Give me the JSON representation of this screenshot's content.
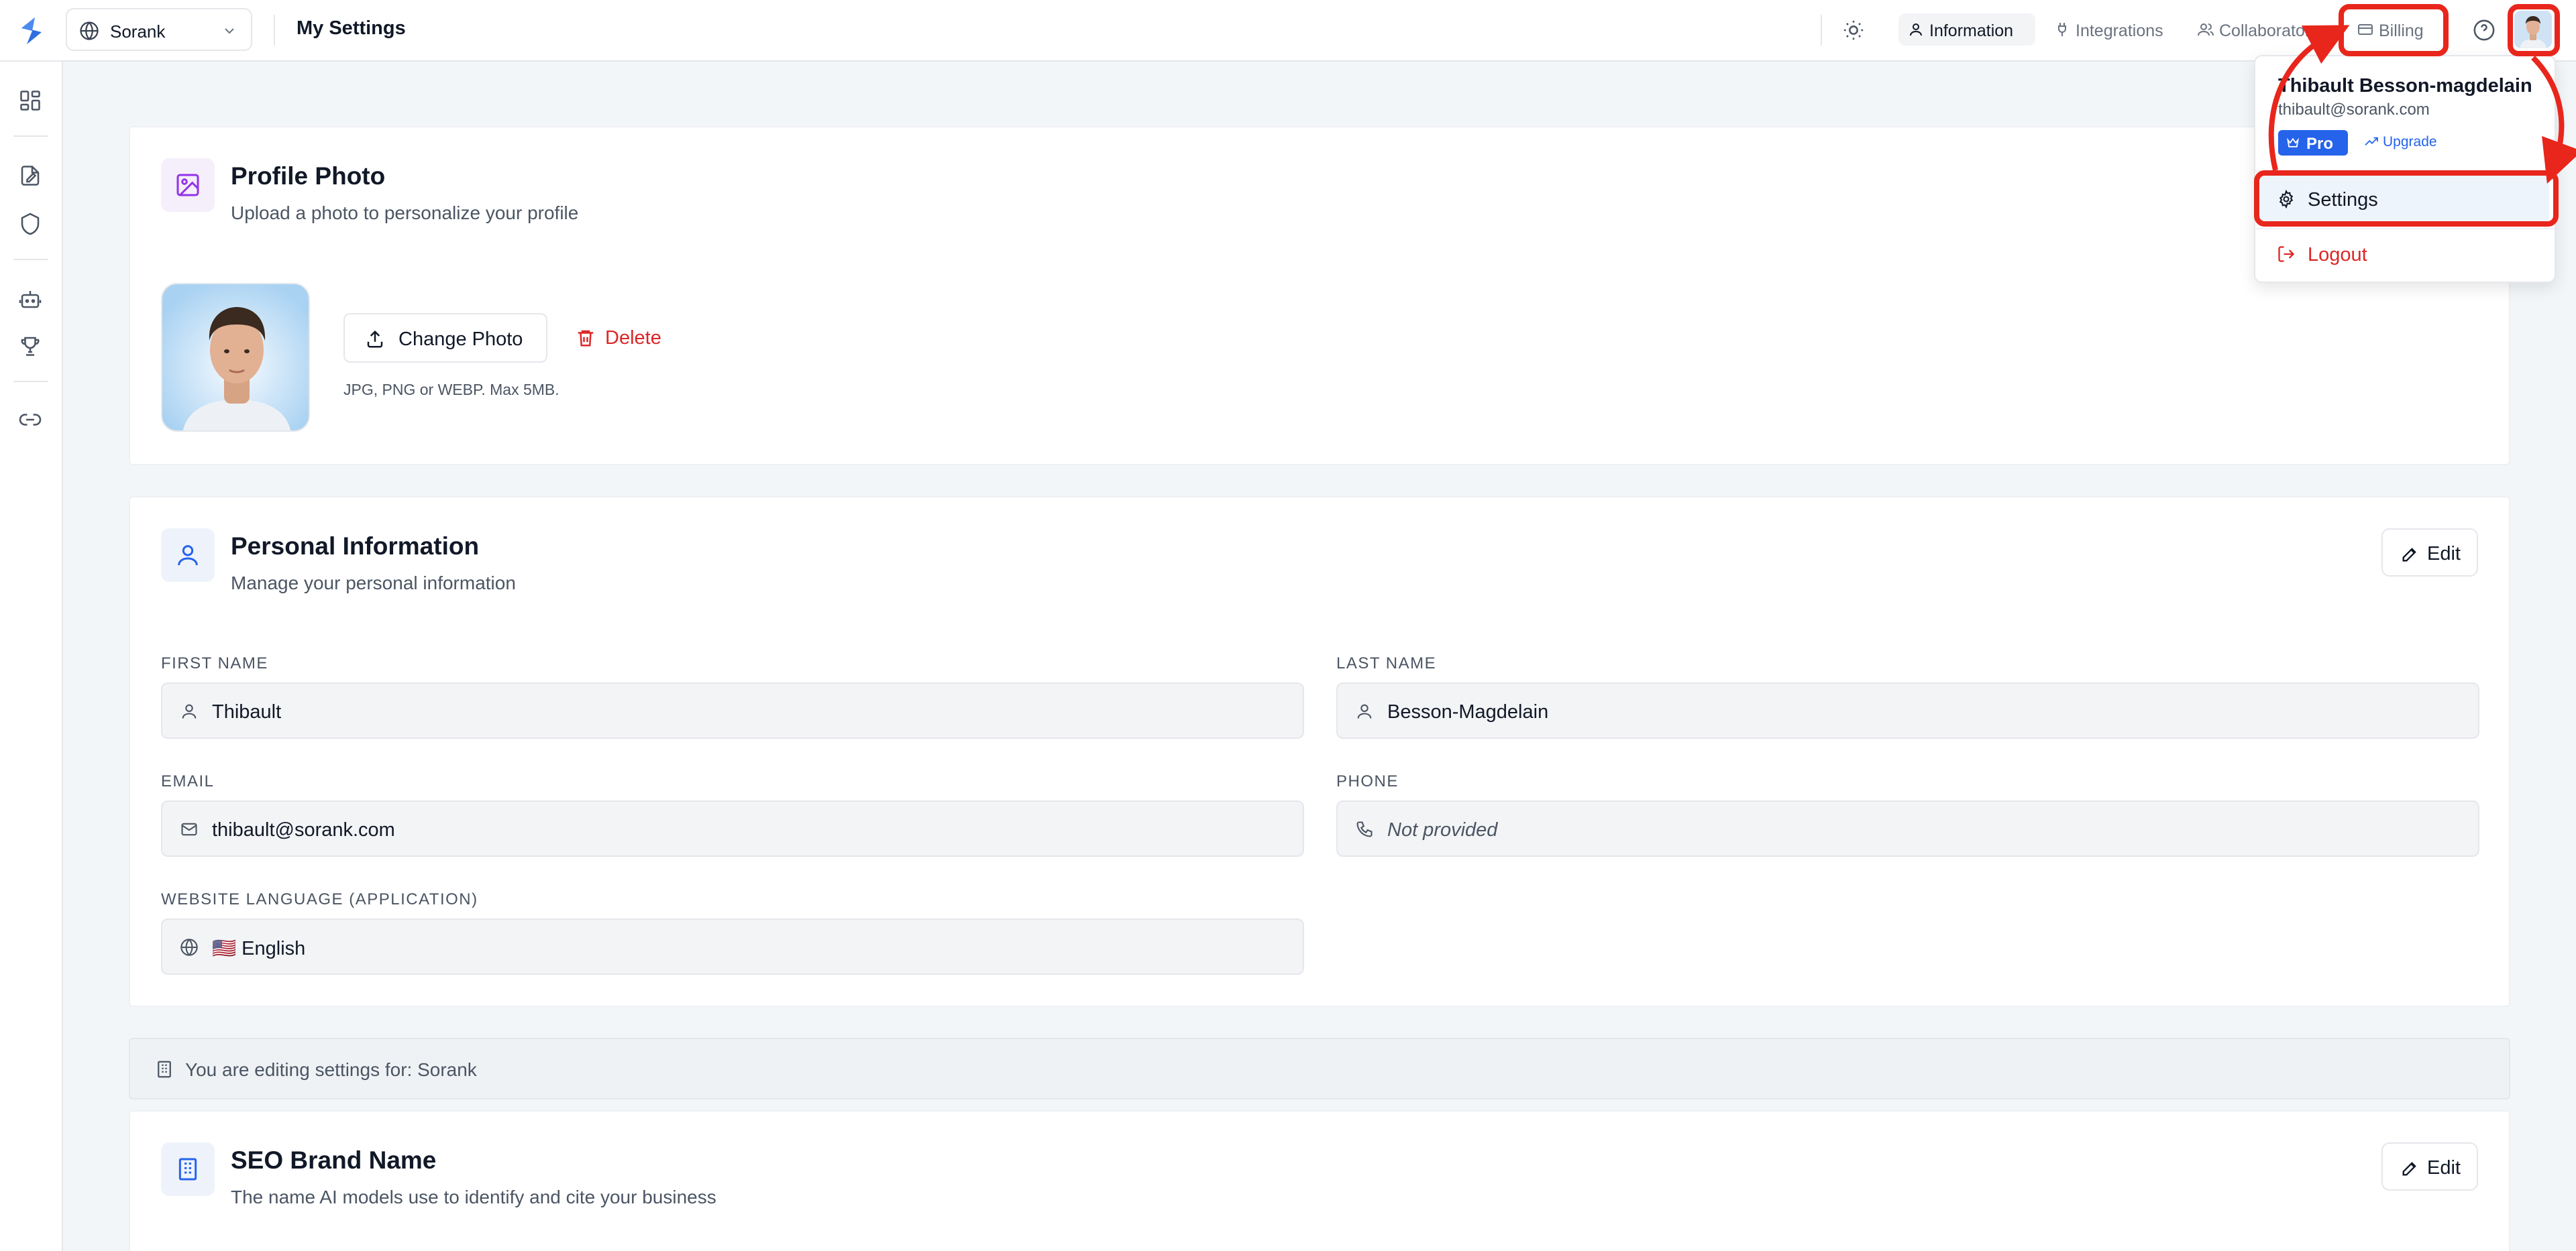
{
  "workspace": {
    "name": "Sorank"
  },
  "header": {
    "title": "My Settings",
    "tabs": [
      {
        "label": "Information",
        "icon": "user-icon",
        "active": true
      },
      {
        "label": "Integrations",
        "icon": "plug-icon",
        "active": false
      },
      {
        "label": "Collaborators",
        "icon": "users-icon",
        "active": false
      },
      {
        "label": "Billing",
        "icon": "credit-card-icon",
        "active": false
      }
    ]
  },
  "sidebar": {
    "icons": [
      "dashboard-icon",
      "document-edit-icon",
      "shield-icon",
      "bot-icon",
      "trophy-icon",
      "link-icon"
    ]
  },
  "profile_photo": {
    "title": "Profile Photo",
    "subtitle": "Upload a photo to personalize your profile",
    "change_label": "Change Photo",
    "delete_label": "Delete",
    "hint": "JPG, PNG or WEBP. Max 5MB."
  },
  "personal_info": {
    "title": "Personal Information",
    "subtitle": "Manage your personal information",
    "edit_label": "Edit",
    "fields": {
      "first_name": {
        "label": "First Name",
        "value": "Thibault"
      },
      "last_name": {
        "label": "Last Name",
        "value": "Besson-Magdelain"
      },
      "email": {
        "label": "Email",
        "value": "thibault@sorank.com"
      },
      "phone": {
        "label": "Phone",
        "value": "Not provided"
      },
      "language": {
        "label": "Website Language (Application)",
        "value": "🇺🇸 English"
      }
    }
  },
  "banner": {
    "text": "You are editing settings for: Sorank"
  },
  "seo_brand": {
    "title": "SEO Brand Name",
    "subtitle": "The name AI models use to identify and cite your business",
    "edit_label": "Edit"
  },
  "user_menu": {
    "name": "Thibault Besson-magdelain",
    "email": "thibault@sorank.com",
    "plan": "Pro",
    "upgrade_label": "Upgrade",
    "items": [
      {
        "label": "Settings",
        "icon": "gear-icon"
      },
      {
        "label": "Logout",
        "icon": "logout-icon"
      }
    ]
  },
  "colors": {
    "accent": "#2563eb",
    "danger": "#dc2626",
    "annotation": "#e8261c"
  }
}
